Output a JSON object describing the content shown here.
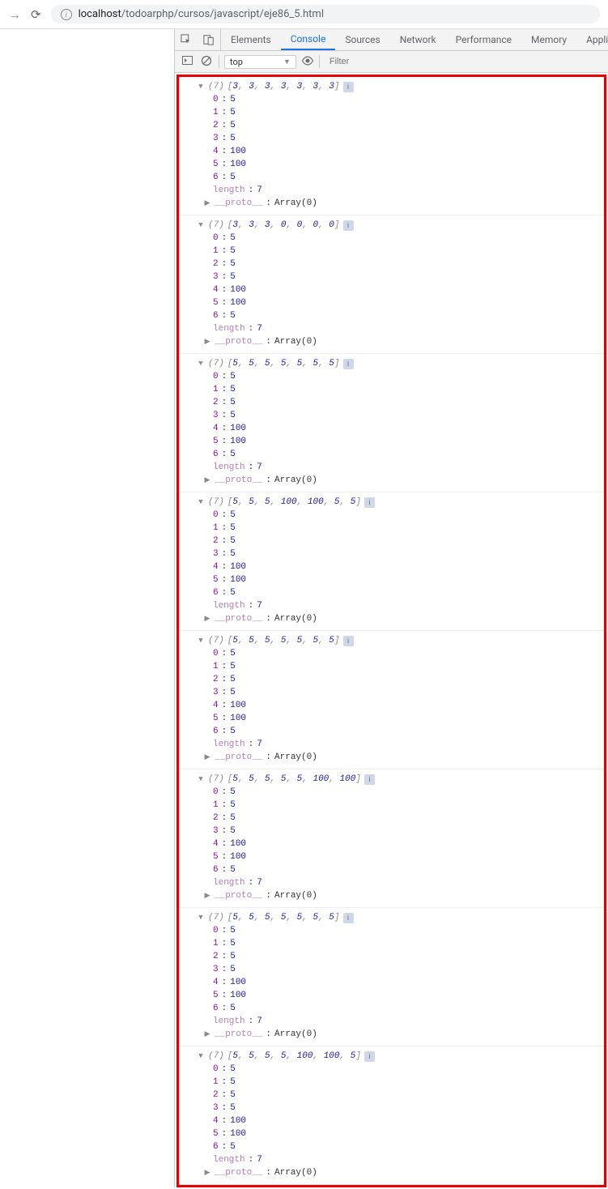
{
  "browser": {
    "url_host": "localhost",
    "url_path": "/todoarphp/cursos/javascript/eje86_5.html"
  },
  "devtools": {
    "tabs": [
      "Elements",
      "Console",
      "Sources",
      "Network",
      "Performance",
      "Memory",
      "Appli"
    ],
    "active_tab": "Console",
    "context": "top",
    "filter_placeholder": "Filter"
  },
  "labels": {
    "length": "length",
    "proto": "__proto__",
    "proto_val": "Array(0)"
  },
  "messages": [
    {
      "summary": "[3, 3, 3, 3, 3, 3, 3]",
      "count": "(7)",
      "items": [
        "5",
        "5",
        "5",
        "5",
        "100",
        "100",
        "5"
      ],
      "length": "7"
    },
    {
      "summary": "[3, 3, 3, 0, 0, 0, 0]",
      "count": "(7)",
      "items": [
        "5",
        "5",
        "5",
        "5",
        "100",
        "100",
        "5"
      ],
      "length": "7"
    },
    {
      "summary": "[5, 5, 5, 5, 5, 5, 5]",
      "count": "(7)",
      "items": [
        "5",
        "5",
        "5",
        "5",
        "100",
        "100",
        "5"
      ],
      "length": "7"
    },
    {
      "summary": "[5, 5, 5, 100, 100, 5, 5]",
      "count": "(7)",
      "items": [
        "5",
        "5",
        "5",
        "5",
        "100",
        "100",
        "5"
      ],
      "length": "7"
    },
    {
      "summary": "[5, 5, 5, 5, 5, 5, 5]",
      "count": "(7)",
      "items": [
        "5",
        "5",
        "5",
        "5",
        "100",
        "100",
        "5"
      ],
      "length": "7"
    },
    {
      "summary": "[5, 5, 5, 5, 5, 100, 100]",
      "count": "(7)",
      "items": [
        "5",
        "5",
        "5",
        "5",
        "100",
        "100",
        "5"
      ],
      "length": "7"
    },
    {
      "summary": "[5, 5, 5, 5, 5, 5, 5]",
      "count": "(7)",
      "items": [
        "5",
        "5",
        "5",
        "5",
        "100",
        "100",
        "5"
      ],
      "length": "7"
    },
    {
      "summary": "[5, 5, 5, 5, 100, 100, 5]",
      "count": "(7)",
      "items": [
        "5",
        "5",
        "5",
        "5",
        "100",
        "100",
        "5"
      ],
      "length": "7"
    }
  ]
}
